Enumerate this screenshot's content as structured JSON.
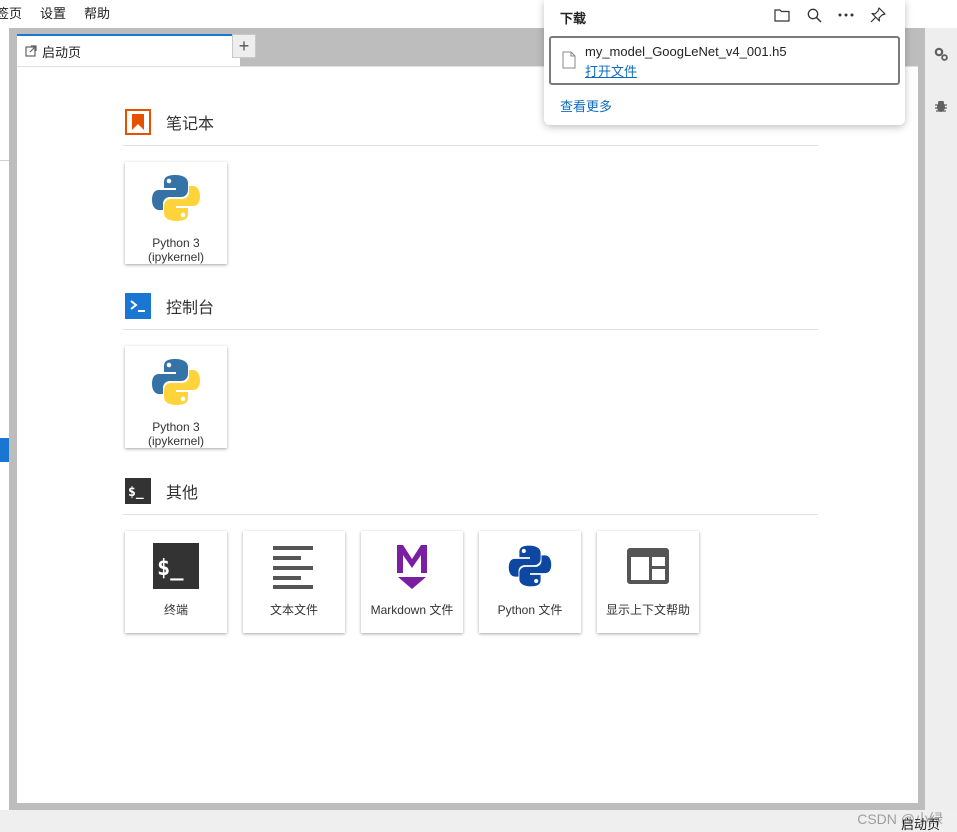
{
  "menubar": {
    "items": [
      "签页",
      "设置",
      "帮助"
    ]
  },
  "tabs": {
    "active_label": "启动页",
    "add_label": "+"
  },
  "launcher": {
    "notebook": {
      "title": "笔记本",
      "cards": [
        {
          "line1": "Python 3",
          "line2": "(ipykernel)"
        }
      ]
    },
    "console": {
      "title": "控制台",
      "cards": [
        {
          "line1": "Python 3",
          "line2": "(ipykernel)"
        }
      ]
    },
    "other": {
      "title": "其他",
      "cards": [
        {
          "label": "终端",
          "icon": "terminal-icon"
        },
        {
          "label": "文本文件",
          "icon": "text-file-icon"
        },
        {
          "label": "Markdown 文件",
          "icon": "markdown-icon"
        },
        {
          "label": "Python 文件",
          "icon": "python-file-icon"
        },
        {
          "label": "显示上下文帮助",
          "icon": "context-help-icon"
        }
      ]
    }
  },
  "downloads": {
    "title": "下载",
    "file_name": "my_model_GoogLeNet_v4_001.h5",
    "open_file": "打开文件",
    "see_more": "查看更多"
  },
  "status": {
    "watermark": "CSDN @小绿",
    "tab_label": "启动页"
  },
  "colors": {
    "accent": "#1976d2",
    "notebook_icon": "#e65100",
    "console_icon": "#1976d2",
    "other_icon": "#333333",
    "markdown": "#7b1fa2",
    "python_blue": "#3572a5",
    "python_yellow": "#ffd43b",
    "link": "#0f6cbd"
  }
}
